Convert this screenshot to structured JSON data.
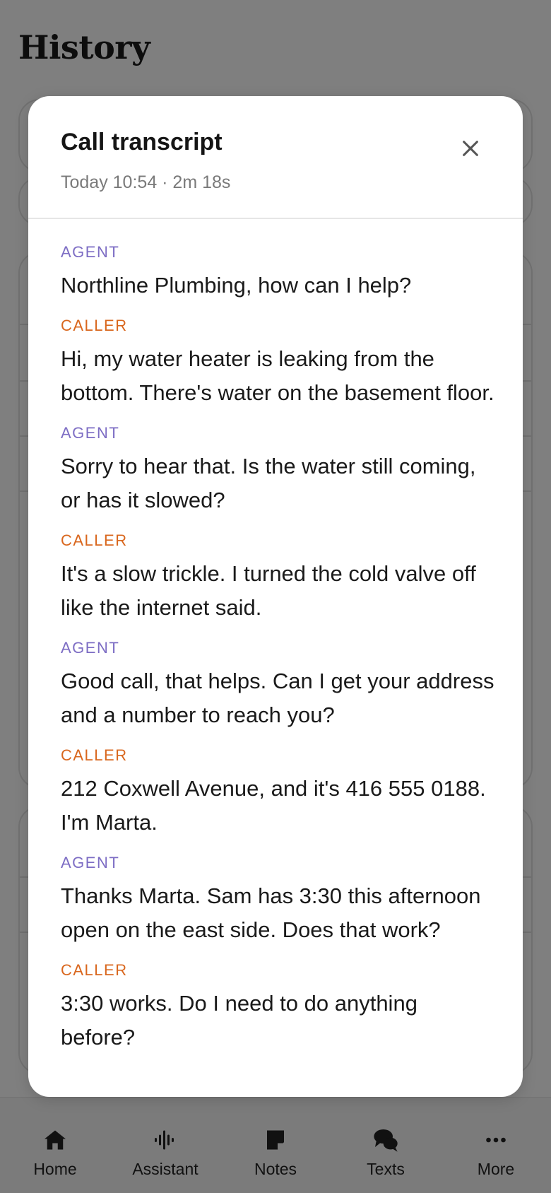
{
  "page": {
    "title": "History"
  },
  "modal": {
    "title": "Call transcript",
    "meta": "Today 10:54 · 2m 18s",
    "close_icon": "close-icon",
    "turns": [
      {
        "speaker": "AGENT",
        "text": "Northline Plumbing, how can I help?"
      },
      {
        "speaker": "CALLER",
        "text": "Hi, my water heater is leaking from the bottom. There's water on the basement floor."
      },
      {
        "speaker": "AGENT",
        "text": "Sorry to hear that. Is the water still coming, or has it slowed?"
      },
      {
        "speaker": "CALLER",
        "text": "It's a slow trickle. I turned the cold valve off like the internet said."
      },
      {
        "speaker": "AGENT",
        "text": "Good call, that helps. Can I get your address and a number to reach you?"
      },
      {
        "speaker": "CALLER",
        "text": "212 Coxwell Avenue, and it's 416 555 0188. I'm Marta."
      },
      {
        "speaker": "AGENT",
        "text": "Thanks Marta. Sam has 3:30 this afternoon open on the east side. Does that work?"
      },
      {
        "speaker": "CALLER",
        "text": "3:30 works. Do I need to do anything before?"
      }
    ]
  },
  "nav": {
    "items": [
      {
        "label": "Home",
        "icon": "home-icon"
      },
      {
        "label": "Assistant",
        "icon": "waveform-icon"
      },
      {
        "label": "Notes",
        "icon": "note-icon"
      },
      {
        "label": "Texts",
        "icon": "chat-bubbles-icon"
      },
      {
        "label": "More",
        "icon": "more-dots-icon"
      }
    ]
  },
  "colors": {
    "agent": "#7d6dc4",
    "caller": "#d9671e",
    "scrim": "rgba(0,0,0,0.5)"
  }
}
